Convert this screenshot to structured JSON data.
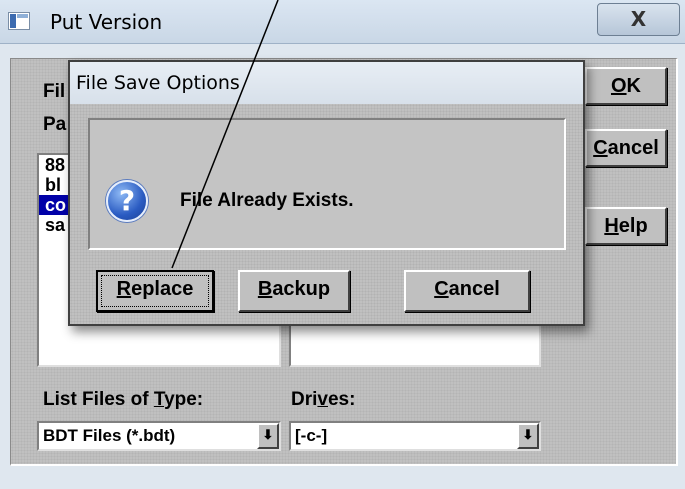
{
  "window": {
    "title": "Put Version",
    "close_glyph": "X"
  },
  "background_dialog": {
    "filename_label_fragment": "Fil",
    "path_label_fragment": "Pa",
    "files": [
      {
        "text": "88",
        "selected": false
      },
      {
        "text": "bl",
        "selected": false
      },
      {
        "text": "co",
        "selected": true
      },
      {
        "text": "sa",
        "selected": false
      }
    ],
    "ok_label": {
      "mnemonic": "O",
      "rest": "K"
    },
    "cancel_label": {
      "pre": "C",
      "rest": "ancel"
    },
    "help_label": {
      "mnemonic": "H",
      "rest": "elp"
    },
    "list_files_label": {
      "pre": "List Files of ",
      "mnemonic": "T",
      "post": "ype:"
    },
    "drives_label": {
      "pre": "Dri",
      "mnemonic": "v",
      "post": "es:"
    },
    "file_type_value": "BDT Files (*.bdt)",
    "drive_value": "[-c-]"
  },
  "modal": {
    "title": "File Save Options",
    "message": "File Already Exists.",
    "icon": "question-icon",
    "buttons": {
      "replace": {
        "mnemonic": "R",
        "rest": "eplace"
      },
      "backup": {
        "mnemonic": "B",
        "rest": "ackup"
      },
      "cancel": {
        "mnemonic": "C",
        "rest": "ancel"
      }
    }
  },
  "colors": {
    "selection": "#0000a8",
    "dialog_face": "#c0c0c0",
    "question_icon": "#2a5bc2"
  }
}
